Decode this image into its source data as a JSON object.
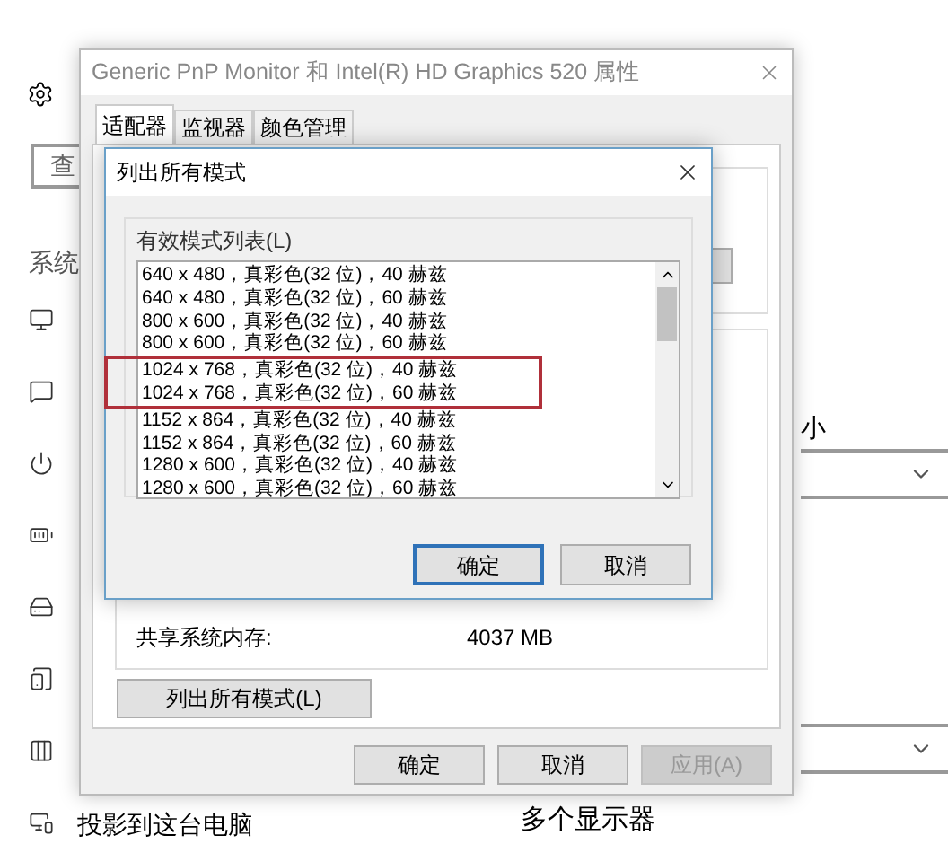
{
  "settings": {
    "search": {
      "placeholder": "查"
    },
    "section_label": "系统",
    "nav_item_label": "投影到这台电脑",
    "size_label": "小",
    "heading": "多个显示器"
  },
  "properties": {
    "title": "Generic PnP Monitor 和 Intel(R) HD Graphics 520 属性",
    "tabs": [
      {
        "label": "适配器",
        "selected": true
      },
      {
        "label": "监视器",
        "selected": false
      },
      {
        "label": "颜色管理",
        "selected": false
      }
    ],
    "info_rows": [
      {
        "label": "共享系统内存:",
        "value": "4037 MB"
      }
    ],
    "list_modes_button": "列出所有模式(L)",
    "buttons": [
      {
        "label": "确定",
        "disabled": false
      },
      {
        "label": "取消",
        "disabled": false
      },
      {
        "label": "应用(A)",
        "disabled": true
      }
    ]
  },
  "modes_dialog": {
    "title": "列出所有模式",
    "group_label": "有效模式列表(L)",
    "modes": [
      {
        "text": "640 x 480，真彩色(32 位)，40 赫兹",
        "highlighted": false
      },
      {
        "text": "640 x 480，真彩色(32 位)，60 赫兹",
        "highlighted": false
      },
      {
        "text": "800 x 600，真彩色(32 位)，40 赫兹",
        "highlighted": false
      },
      {
        "text": "800 x 600，真彩色(32 位)，60 赫兹",
        "highlighted": false
      },
      {
        "text": "1024 x 768，真彩色(32 位)，40 赫兹",
        "highlighted": true
      },
      {
        "text": "1024 x 768，真彩色(32 位)，60 赫兹",
        "highlighted": true
      },
      {
        "text": "1152 x 864，真彩色(32 位)，40 赫兹",
        "highlighted": false
      },
      {
        "text": "1152 x 864，真彩色(32 位)，60 赫兹",
        "highlighted": false
      },
      {
        "text": "1280 x 600，真彩色(32 位)，40 赫兹",
        "highlighted": false
      },
      {
        "text": "1280 x 600，真彩色(32 位)，60 赫兹",
        "highlighted": false
      }
    ],
    "buttons": [
      {
        "label": "确定",
        "focused": true
      },
      {
        "label": "取消",
        "focused": false
      }
    ]
  }
}
